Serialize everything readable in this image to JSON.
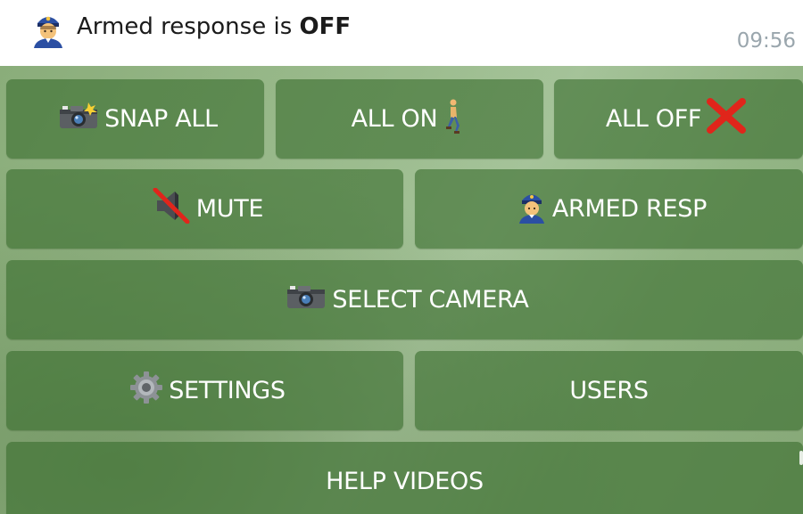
{
  "message": {
    "icon": "police-officer-icon",
    "text_prefix": "Armed response is ",
    "status": "OFF",
    "time": "09:56"
  },
  "keyboard": {
    "rows": [
      [
        {
          "label": "SNAP ALL",
          "icon": "camera-flash-icon"
        },
        {
          "label": "ALL ON",
          "icon": "person-walking-icon"
        },
        {
          "label": "ALL OFF",
          "icon": "cross-mark-icon"
        }
      ],
      [
        {
          "label": "MUTE",
          "icon": "muted-speaker-icon"
        },
        {
          "label": "ARMED RESP",
          "icon": "police-officer-icon"
        }
      ],
      [
        {
          "label": "SELECT CAMERA",
          "icon": "camera-icon"
        }
      ],
      [
        {
          "label": "SETTINGS",
          "icon": "gear-icon"
        },
        {
          "label": "USERS",
          "icon": ""
        }
      ],
      [
        {
          "label": "HELP VIDEOS",
          "icon": ""
        }
      ]
    ]
  },
  "colors": {
    "key_bg": "#4f8a40",
    "key_text": "#ffffff",
    "cross": "#e0251b",
    "time": "#9aa6ad"
  }
}
